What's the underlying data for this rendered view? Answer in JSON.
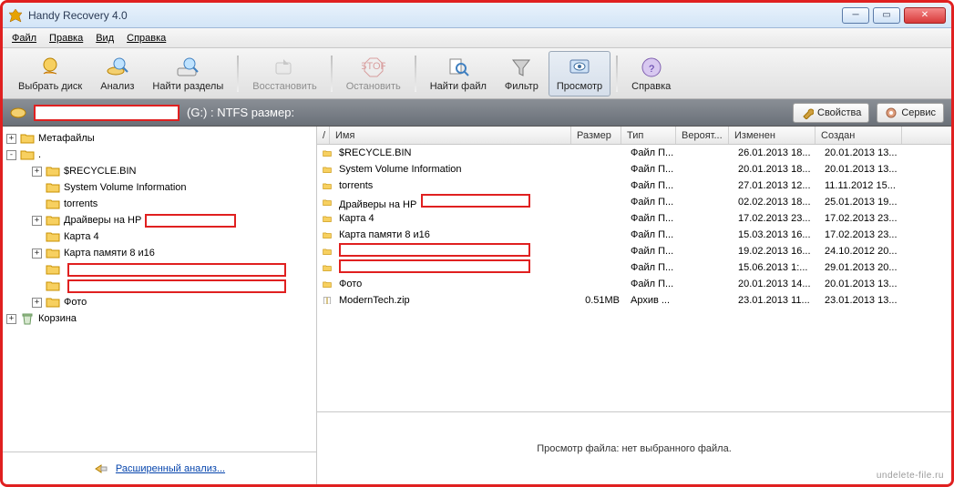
{
  "window": {
    "title": "Handy Recovery 4.0"
  },
  "menu": {
    "file": "Файл",
    "edit": "Правка",
    "view": "Вид",
    "help": "Справка"
  },
  "toolbar": {
    "select_disk": "Выбрать диск",
    "analyze": "Анализ",
    "find_partitions": "Найти разделы",
    "recover": "Восстановить",
    "stop": "Остановить",
    "find_file": "Найти файл",
    "filter": "Фильтр",
    "preview": "Просмотр",
    "help": "Справка"
  },
  "pathbar": {
    "drive_suffix": "(G:) : NTFS размер:",
    "properties": "Свойства",
    "service": "Сервис"
  },
  "tree": {
    "metafiles": "Метафайлы",
    "root_dot": ".",
    "items": [
      {
        "label": "$RECYCLE.BIN",
        "expandable": true,
        "indent": 2
      },
      {
        "label": "System Volume Information",
        "expandable": false,
        "indent": 2
      },
      {
        "label": "torrents",
        "expandable": false,
        "indent": 2
      },
      {
        "label": "Драйверы на HP",
        "expandable": true,
        "indent": 2,
        "red": true
      },
      {
        "label": "Карта 4",
        "expandable": false,
        "indent": 2
      },
      {
        "label": "Карта памяти 8 и16",
        "expandable": true,
        "indent": 2
      },
      {
        "label": "",
        "expandable": false,
        "indent": 2,
        "red": true
      },
      {
        "label": "",
        "expandable": false,
        "indent": 2,
        "red": true
      },
      {
        "label": "Фото",
        "expandable": true,
        "indent": 2
      }
    ],
    "recycle": "Корзина",
    "footer_link": "Расширенный анализ..."
  },
  "columns": {
    "arrow": "/",
    "name": "Имя",
    "size": "Размер",
    "type": "Тип",
    "prob": "Вероят...",
    "modified": "Изменен",
    "created": "Создан"
  },
  "rows": [
    {
      "icon": "folder",
      "name": "$RECYCLE.BIN",
      "size": "",
      "type": "Файл П...",
      "prob": "",
      "mod": "26.01.2013 18...",
      "created": "20.01.2013 13..."
    },
    {
      "icon": "folder",
      "name": "System Volume Information",
      "size": "",
      "type": "Файл П...",
      "prob": "",
      "mod": "20.01.2013 18...",
      "created": "20.01.2013 13..."
    },
    {
      "icon": "folder",
      "name": "torrents",
      "size": "",
      "type": "Файл П...",
      "prob": "",
      "mod": "27.01.2013 12...",
      "created": "11.11.2012 15..."
    },
    {
      "icon": "folder",
      "name": "Драйверы на HP",
      "size": "",
      "type": "Файл П...",
      "prob": "",
      "mod": "02.02.2013 18...",
      "created": "25.01.2013 19...",
      "red": true
    },
    {
      "icon": "folder",
      "name": "Карта 4",
      "size": "",
      "type": "Файл П...",
      "prob": "",
      "mod": "17.02.2013 23...",
      "created": "17.02.2013 23..."
    },
    {
      "icon": "folder",
      "name": "Карта памяти 8 и16",
      "size": "",
      "type": "Файл П...",
      "prob": "",
      "mod": "15.03.2013 16...",
      "created": "17.02.2013 23..."
    },
    {
      "icon": "folder",
      "name": "",
      "size": "",
      "type": "Файл П...",
      "prob": "",
      "mod": "19.02.2013 16...",
      "created": "24.10.2012 20...",
      "red": true
    },
    {
      "icon": "folder",
      "name": "",
      "size": "",
      "type": "Файл П...",
      "prob": "",
      "mod": "15.06.2013 1:...",
      "created": "29.01.2013 20...",
      "red": true
    },
    {
      "icon": "folder",
      "name": "Фото",
      "size": "",
      "type": "Файл П...",
      "prob": "",
      "mod": "20.01.2013 14...",
      "created": "20.01.2013 13..."
    },
    {
      "icon": "zip",
      "name": "ModernTech.zip",
      "size": "0.51MB",
      "type": "Архив ...",
      "prob": "",
      "mod": "23.01.2013 11...",
      "created": "23.01.2013 13..."
    }
  ],
  "preview": {
    "empty": "Просмотр файла: нет выбранного файла."
  },
  "watermark": "undelete-file.ru"
}
